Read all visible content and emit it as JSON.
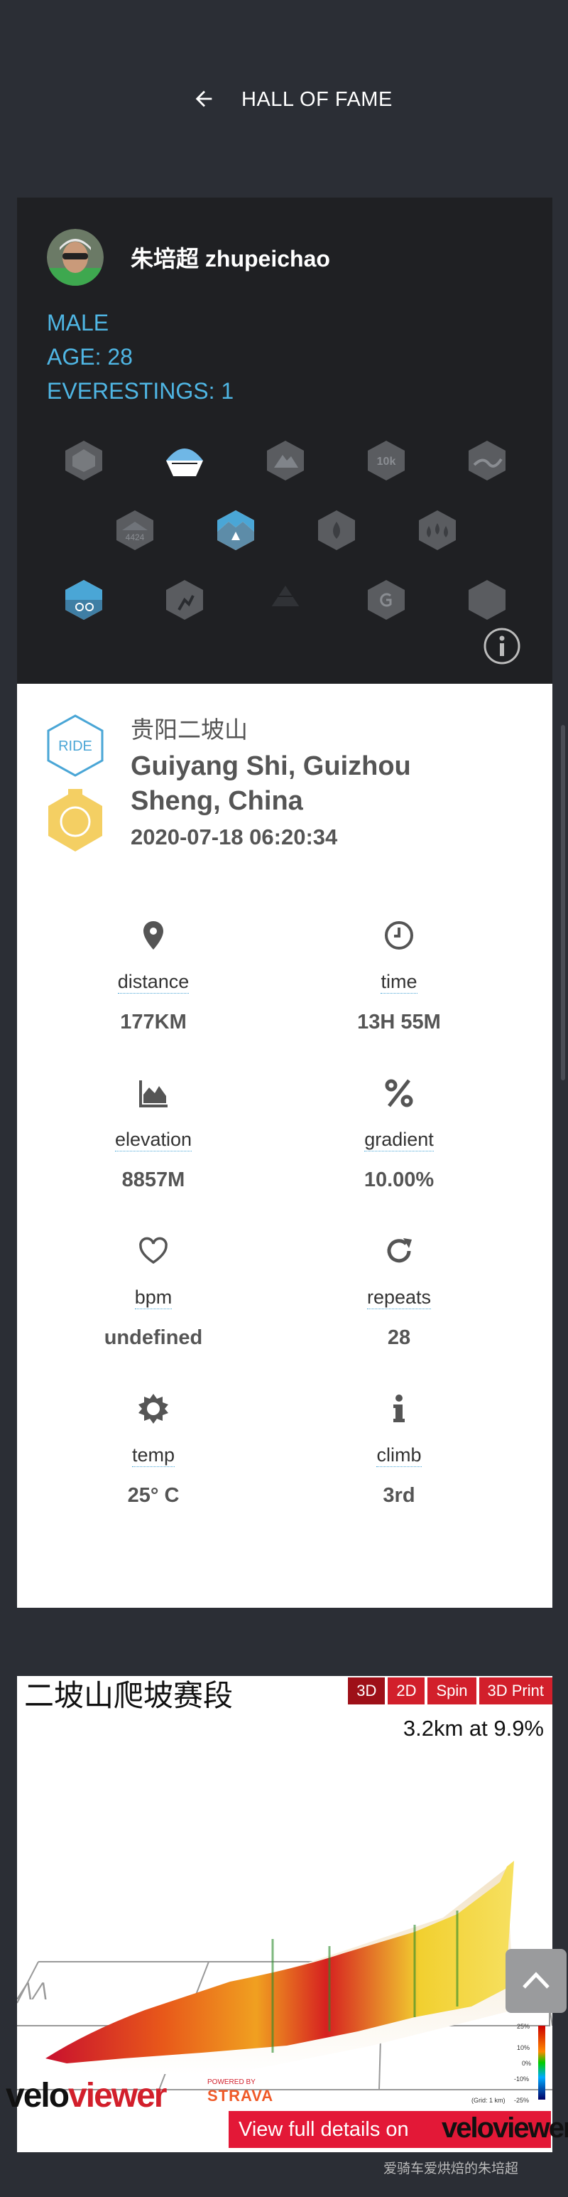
{
  "header": {
    "title": "HALL OF FAME",
    "back_icon": "arrow-left-icon"
  },
  "profile": {
    "name": "朱培超 zhupeichao",
    "gender": "MALE",
    "age": "AGE: 28",
    "everestings": "EVERESTINGS: 1",
    "badge_row1": [
      "hexagon-mountain-icon",
      "cyclist-dome-icon",
      "mountain-10k-icon",
      "10k-icon",
      "route-icon"
    ],
    "badge_row2": [
      "4424-icon",
      "peak-icon",
      "drop-icon",
      "triple-drop-icon"
    ],
    "badge_row3": [
      "cyclist-hex-icon",
      "runner-hex-icon",
      "pyramid-icon",
      "g-icon",
      "hexagon-plain-icon"
    ],
    "badge_text": {
      "b13": "10k",
      "b21": "4424"
    }
  },
  "activity": {
    "type": "RIDE",
    "route_name": "贵阳二坡山",
    "location": "Guiyang Shi, Guizhou Sheng, China",
    "datetime": "2020-07-18 06:20:34",
    "stats": [
      {
        "label": "distance",
        "value": "177KM",
        "icon": "location-pin-icon"
      },
      {
        "label": "time",
        "value": "13H 55M",
        "icon": "clock-icon"
      },
      {
        "label": "elevation",
        "value": "8857M",
        "icon": "area-chart-icon"
      },
      {
        "label": "gradient",
        "value": "10.00%",
        "icon": "percent-icon"
      },
      {
        "label": "bpm",
        "value": "undefined",
        "icon": "heart-icon"
      },
      {
        "label": "repeats",
        "value": "28",
        "icon": "repeat-icon"
      },
      {
        "label": "temp",
        "value": "25° C",
        "icon": "sun-icon"
      },
      {
        "label": "climb",
        "value": "3rd",
        "icon": "info-icon"
      }
    ]
  },
  "veloviewer": {
    "segment_title": "二坡山爬坡赛段",
    "buttons": [
      "3D",
      "2D",
      "Spin",
      "3D Print"
    ],
    "summary": "3.2km at 9.9%",
    "legend": [
      "25%",
      "10%",
      "0%",
      "-10%",
      "-25%"
    ],
    "grid_note": "(Grid: 1 km)",
    "logo": {
      "a": "velo",
      "b": "viewer"
    },
    "powered_by": "POWERED BY",
    "strava": "STRAVA",
    "view_full": "View full details on",
    "view_full_logo": "veloviewer"
  },
  "watermark": "爱骑车爱烘焙的朱培超"
}
